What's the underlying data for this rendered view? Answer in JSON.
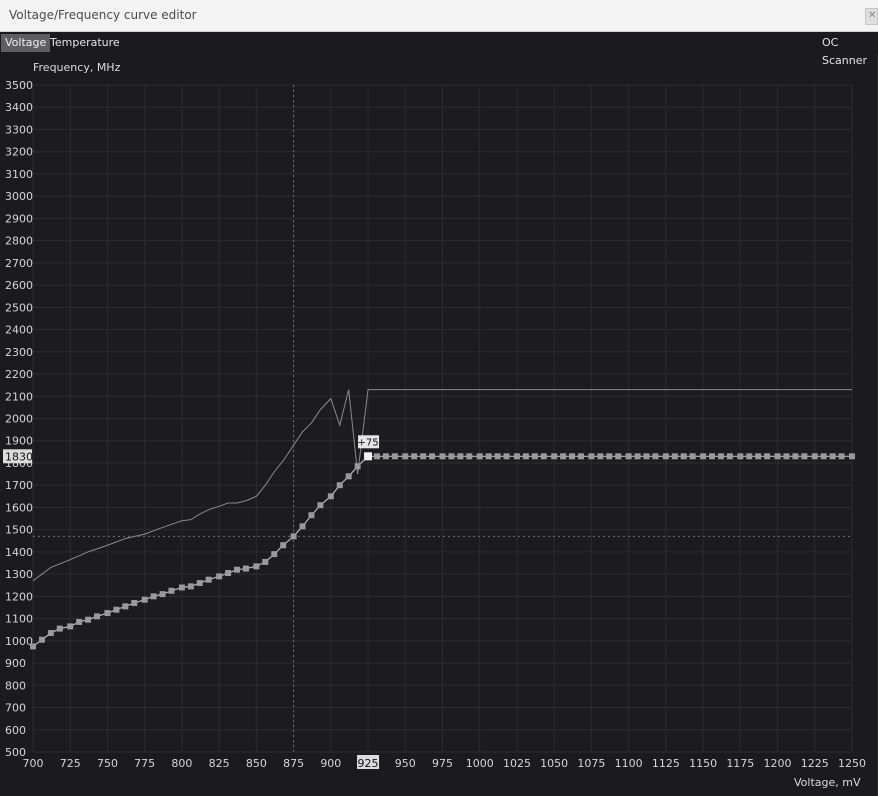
{
  "window": {
    "title": "Voltage/Frequency curve editor",
    "close_icon": "close-icon"
  },
  "tabs": {
    "voltage": "Voltage",
    "temperature": "Temperature",
    "oc_scanner": "OC Scanner"
  },
  "colors": {
    "background": "#1b1b1d",
    "grid": "#2c2c30",
    "curve": "#b8b8b8",
    "point": "#9a9a9a",
    "selected_point": "#f2f2f2",
    "guide": "#6f6f6f"
  },
  "chart_data": {
    "type": "line",
    "xlabel": "Voltage, mV",
    "ylabel": "Frequency, MHz",
    "xlim": [
      700,
      1250
    ],
    "ylim": [
      500,
      3500
    ],
    "x_ticks": [
      700,
      725,
      750,
      775,
      800,
      825,
      850,
      875,
      900,
      925,
      950,
      975,
      1000,
      1025,
      1050,
      1075,
      1100,
      1125,
      1150,
      1175,
      1200,
      1225,
      1250
    ],
    "y_ticks": [
      500,
      600,
      700,
      800,
      900,
      1000,
      1100,
      1200,
      1300,
      1400,
      1500,
      1600,
      1700,
      1800,
      1900,
      2000,
      2100,
      2200,
      2300,
      2400,
      2500,
      2600,
      2700,
      2800,
      2900,
      3000,
      3100,
      3200,
      3300,
      3400,
      3500
    ],
    "grid": true,
    "series": [
      {
        "x": [
          700,
          712,
          725,
          737,
          750,
          762,
          775,
          787,
          800,
          806,
          812,
          818,
          825,
          831,
          837,
          843,
          850,
          856,
          862,
          868,
          875,
          881,
          887,
          893,
          900,
          906,
          912,
          918,
          925,
          931,
          937,
          1250
        ],
        "y": [
          1270,
          1330,
          1365,
          1400,
          1430,
          1460,
          1480,
          1510,
          1540,
          1545,
          1570,
          1590,
          1605,
          1620,
          1620,
          1630,
          1650,
          1700,
          1760,
          1810,
          1880,
          1940,
          1980,
          2040,
          2090,
          1970,
          2130,
          1750,
          2130,
          2130,
          2130,
          2130
        ]
      },
      {
        "x": [
          700,
          706,
          712,
          718,
          725,
          731,
          737,
          743,
          750,
          756,
          762,
          768,
          775,
          781,
          787,
          793,
          800,
          806,
          812,
          818,
          825,
          831,
          837,
          843,
          850,
          856,
          862,
          868,
          875,
          881,
          887,
          893,
          900,
          906,
          912,
          918,
          925,
          931,
          937,
          943,
          950,
          956,
          962,
          968,
          975,
          981,
          987,
          993,
          1000,
          1006,
          1012,
          1018,
          1025,
          1031,
          1037,
          1043,
          1050,
          1056,
          1062,
          1068,
          1075,
          1081,
          1087,
          1093,
          1100,
          1106,
          1112,
          1118,
          1125,
          1131,
          1137,
          1143,
          1150,
          1156,
          1162,
          1168,
          1175,
          1181,
          1187,
          1193,
          1200,
          1206,
          1212,
          1218,
          1225,
          1231,
          1237,
          1243,
          1250
        ],
        "y": [
          975,
          1005,
          1035,
          1055,
          1065,
          1085,
          1095,
          1110,
          1125,
          1140,
          1155,
          1170,
          1185,
          1200,
          1210,
          1225,
          1240,
          1245,
          1260,
          1275,
          1290,
          1305,
          1320,
          1325,
          1335,
          1355,
          1390,
          1430,
          1470,
          1515,
          1565,
          1610,
          1650,
          1700,
          1740,
          1785,
          1830,
          1830,
          1830,
          1830,
          1830,
          1830,
          1830,
          1830,
          1830,
          1830,
          1830,
          1830,
          1830,
          1830,
          1830,
          1830,
          1830,
          1830,
          1830,
          1830,
          1830,
          1830,
          1830,
          1830,
          1830,
          1830,
          1830,
          1830,
          1830,
          1830,
          1830,
          1830,
          1830,
          1830,
          1830,
          1830,
          1830,
          1830,
          1830,
          1830,
          1830,
          1830,
          1830,
          1830,
          1830,
          1830,
          1830,
          1830,
          1830,
          1830,
          1830,
          1830,
          1830
        ]
      }
    ],
    "selected_point": {
      "x": 925,
      "y": 1830,
      "offset_label": "+75"
    },
    "current_voltage": 875,
    "current_frequency": 1470,
    "highlight_x_label": "925",
    "highlight_y_label": "1830"
  }
}
